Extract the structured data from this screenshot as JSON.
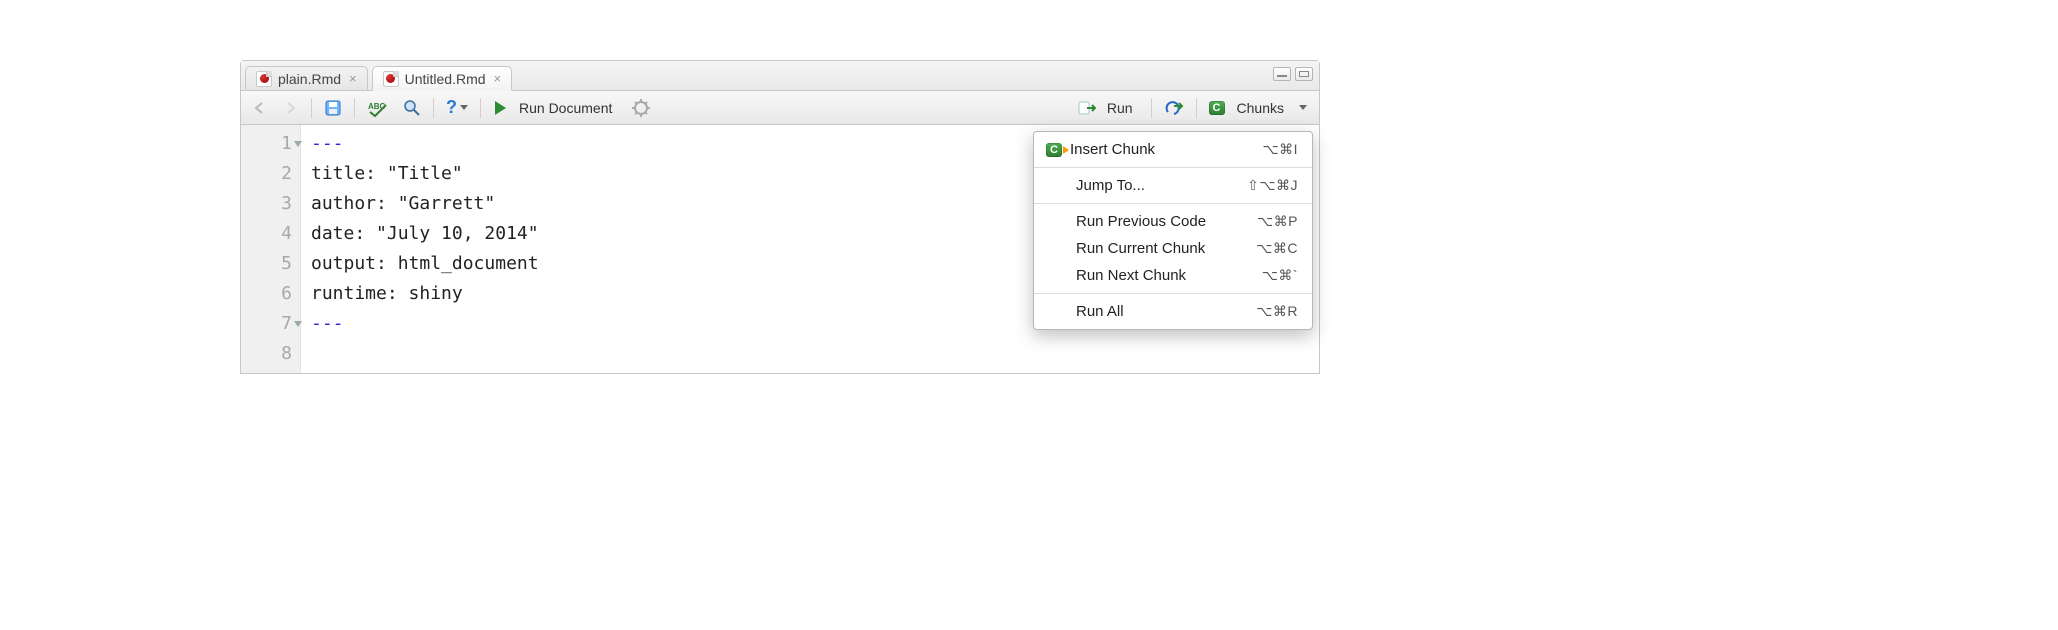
{
  "tabs": [
    {
      "label": "plain.Rmd",
      "active": false
    },
    {
      "label": "Untitled.Rmd",
      "active": true
    }
  ],
  "toolbar": {
    "run_document_label": "Run Document",
    "run_label": "Run",
    "chunks_label": "Chunks"
  },
  "code_lines": [
    {
      "n": "1",
      "text": "---",
      "fold": true,
      "yaml": true
    },
    {
      "n": "2",
      "text": "title: \"Title\""
    },
    {
      "n": "3",
      "text": "author: \"Garrett\""
    },
    {
      "n": "4",
      "text": "date: \"July 10, 2014\""
    },
    {
      "n": "5",
      "text": "output: html_document"
    },
    {
      "n": "6",
      "text": "runtime: shiny"
    },
    {
      "n": "7",
      "text": "---",
      "fold": true,
      "yaml": true
    },
    {
      "n": "8",
      "text": ""
    }
  ],
  "menu": {
    "items": [
      {
        "label": "Insert Chunk",
        "shortcut": "⌥⌘I",
        "icon": "insert-chunk"
      },
      {
        "sep": true
      },
      {
        "label": "Jump To...",
        "shortcut": "⇧⌥⌘J"
      },
      {
        "sep": true
      },
      {
        "label": "Run Previous Code",
        "shortcut": "⌥⌘P"
      },
      {
        "label": "Run Current Chunk",
        "shortcut": "⌥⌘C"
      },
      {
        "label": "Run Next Chunk",
        "shortcut": "⌥⌘`"
      },
      {
        "sep": true
      },
      {
        "label": "Run All",
        "shortcut": "⌥⌘R"
      }
    ]
  }
}
